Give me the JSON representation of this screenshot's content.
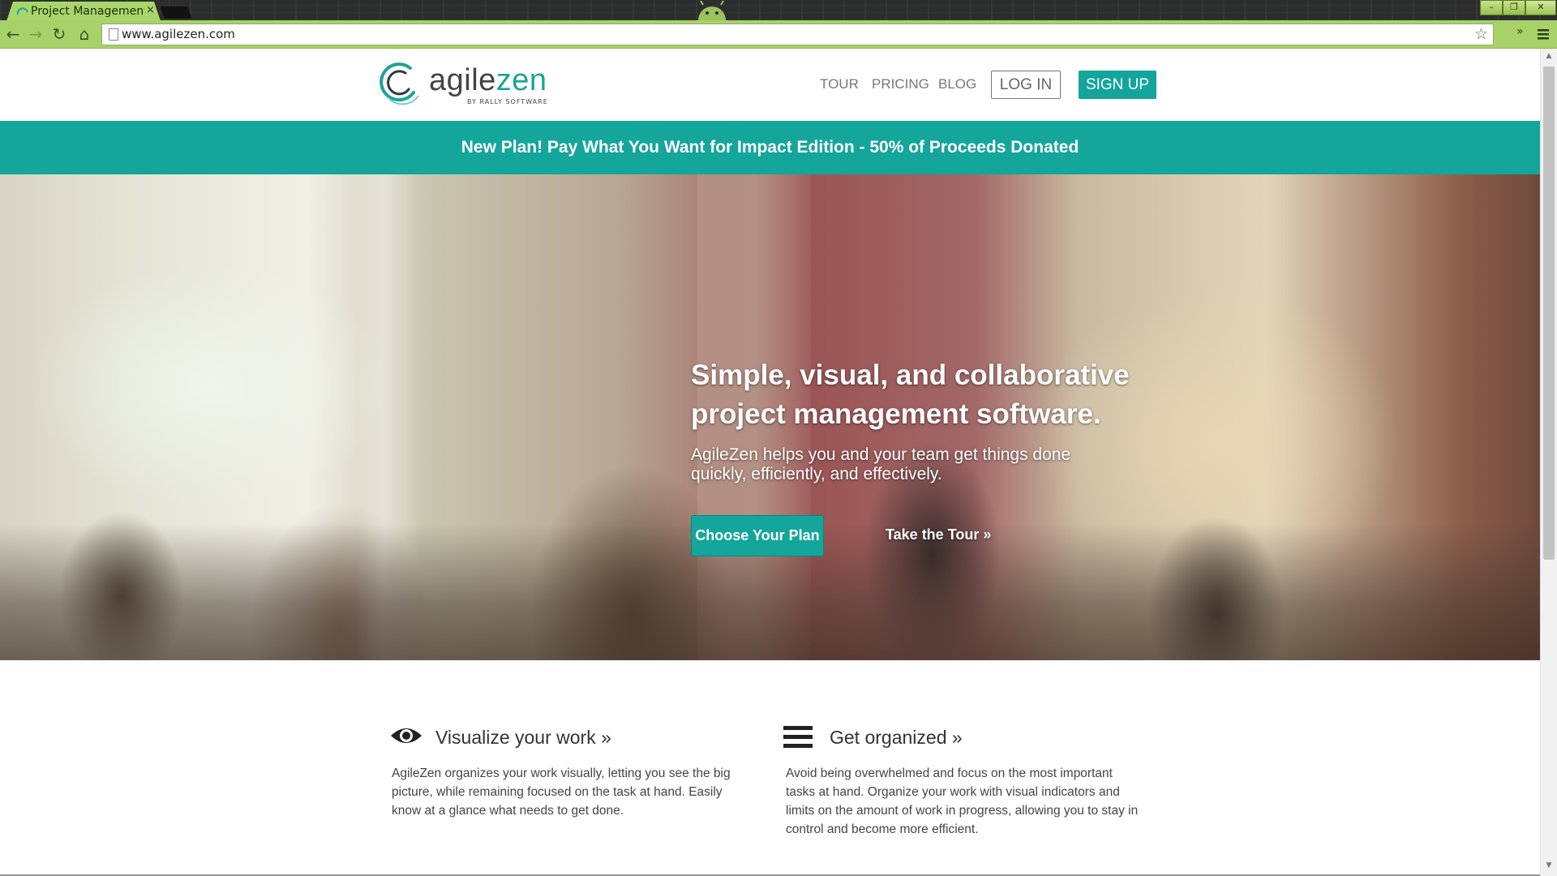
{
  "browser": {
    "tab_title": "Project Management",
    "tab_close": "×",
    "url": "www.agilezen.com",
    "extensions_chevron": "»",
    "window_buttons": [
      "–",
      "❐",
      "✕"
    ],
    "nav_glyphs": {
      "back": "←",
      "forward": "→",
      "reload": "↻",
      "home": "⌂",
      "star": "☆"
    }
  },
  "site": {
    "logo": {
      "word_plain": "agile",
      "word_accent": "zen",
      "byline": "BY RALLY SOFTWARE"
    },
    "nav": {
      "tour": "TOUR",
      "pricing": "PRICING",
      "blog": "BLOG",
      "login": "LOG IN",
      "signup": "SIGN UP"
    },
    "banner": "New Plan! Pay What You Want for Impact Edition - 50% of Proceeds Donated",
    "hero": {
      "title": "Simple, visual, and collaborative project management software.",
      "subtitle": "AgileZen helps you and your team get things done quickly, efficiently, and effectively.",
      "cta_primary": "Choose Your Plan",
      "cta_secondary": "Take the Tour »"
    },
    "features": [
      {
        "icon": "eye-icon",
        "title": "Visualize your work »",
        "body": "AgileZen organizes your work visually, letting you see the big picture, while remaining focused on the task at hand. Easily know at a glance what needs to get done."
      },
      {
        "icon": "list-icon",
        "title": "Get organized »",
        "body": "Avoid being overwhelmed and focus on the most important tasks at hand. Organize your work with visual indicators and limits on the amount of work in progress, allowing you to stay in control and become more efficient."
      }
    ]
  },
  "colors": {
    "brand": "#14a59b",
    "chrome": "#a8d16a"
  }
}
